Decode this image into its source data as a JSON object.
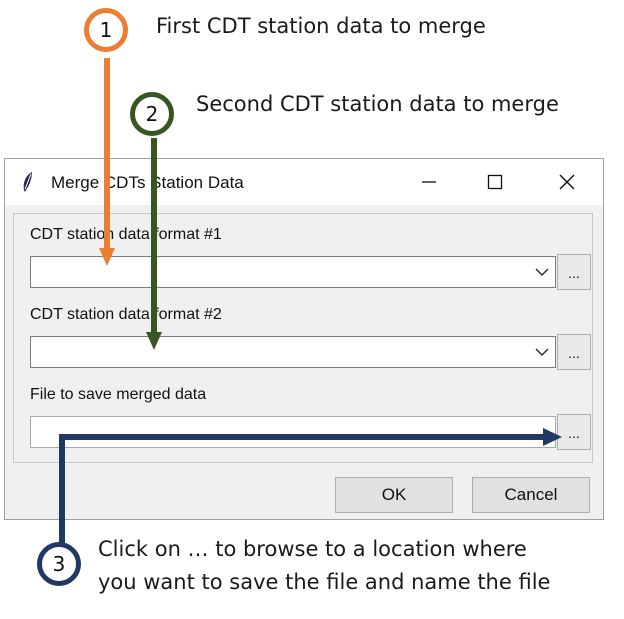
{
  "annotations": {
    "step1": {
      "number": "1",
      "text": "First CDT station data to merge",
      "color": "#ed7d31"
    },
    "step2": {
      "number": "2",
      "text": "Second CDT station data to merge",
      "color": "#375623"
    },
    "step3": {
      "number": "3",
      "line1": "Click on … to browse to a location where",
      "line2": "you want to save the file and name the file",
      "color": "#1f3864"
    }
  },
  "dialog": {
    "title": "Merge CDTs Station Data",
    "app_icon": "feather-icon",
    "titlebar_buttons": [
      "minimize-icon",
      "maximize-icon",
      "close-icon"
    ],
    "fields": [
      {
        "label": "CDT station data format #1",
        "value": "",
        "browse_label": "..."
      },
      {
        "label": "CDT station data format #2",
        "value": "",
        "browse_label": "..."
      },
      {
        "label": "File to save merged data",
        "value": "",
        "browse_label": "..."
      }
    ],
    "ok_label": "OK",
    "cancel_label": "Cancel"
  }
}
